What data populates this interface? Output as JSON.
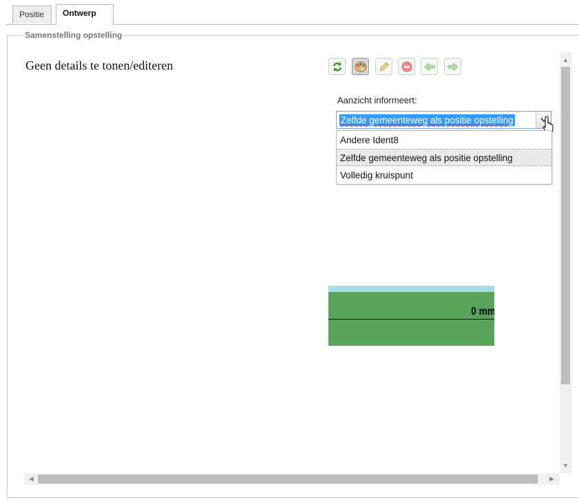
{
  "tabs": [
    {
      "label": "Positie"
    },
    {
      "label": "Ontwerp"
    }
  ],
  "fieldset": {
    "legend": "Samenstelling opstelling"
  },
  "main": {
    "message": "Geen details te tonen/editeren"
  },
  "toolbar": {
    "buttons": [
      {
        "icon": "refresh-icon"
      },
      {
        "icon": "palette-icon",
        "active": true
      },
      {
        "icon": "pencil-icon"
      },
      {
        "icon": "delete-icon"
      },
      {
        "icon": "arrow-left-icon"
      },
      {
        "icon": "arrow-right-icon"
      }
    ]
  },
  "view": {
    "label": "Aanzicht informeert:",
    "selected": "Zelfde gemeenteweg als positie opstelling",
    "options": [
      "Andere Ident8",
      "Zelfde gemeenteweg als positie opstelling",
      "Volledig kruispunt"
    ]
  },
  "graphic": {
    "measure_label": "0 mm",
    "colors": {
      "sky": "#a8d9e6",
      "grass": "#5aa35a"
    }
  }
}
